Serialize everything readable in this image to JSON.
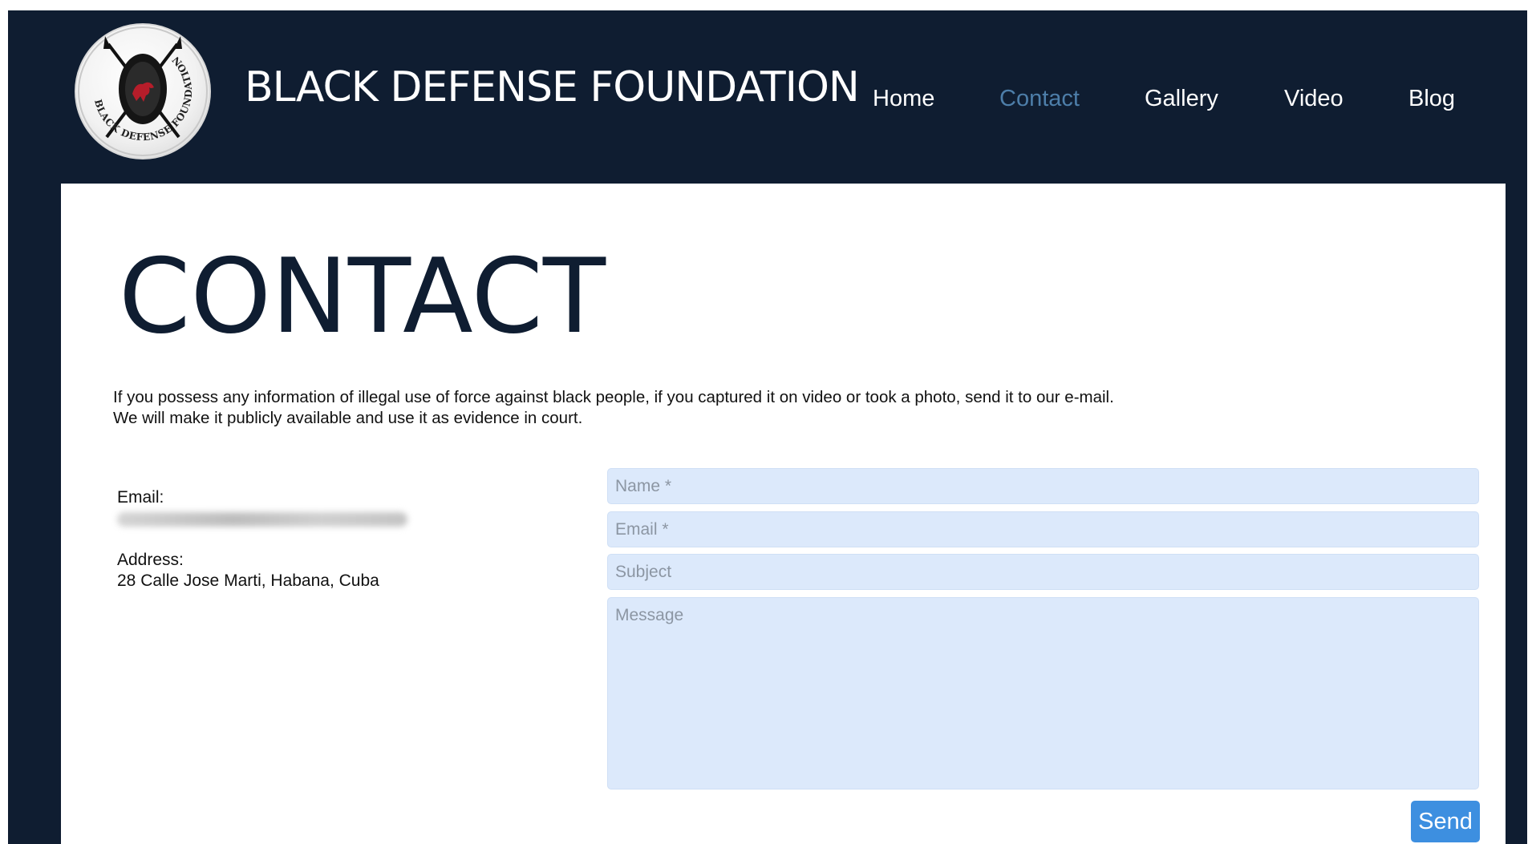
{
  "header": {
    "brand": "BLACK DEFENSE FOUNDATION",
    "logo_text": "BLACK DEFENSE FOUNDATION",
    "nav": [
      {
        "label": "Home",
        "active": false
      },
      {
        "label": "Contact",
        "active": true
      },
      {
        "label": "Gallery",
        "active": false
      },
      {
        "label": "Video",
        "active": false
      },
      {
        "label": "Blog",
        "active": false
      }
    ]
  },
  "main": {
    "title": "CONTACT",
    "intro": "If you possess any information of illegal use of force against black people, if you captured it on video or took a photo, send it to our e-mail. We will make it publicly available and use it as evidence in court.",
    "email_label": "Email:",
    "address_label": "Address:",
    "address_value": "28 Calle Jose Marti, Habana, Cuba"
  },
  "form": {
    "name_placeholder": "Name *",
    "email_placeholder": "Email *",
    "subject_placeholder": "Subject",
    "message_placeholder": "Message",
    "send_label": "Send"
  },
  "colors": {
    "header_bg": "#0f1d31",
    "nav_active": "#4d7ea9",
    "field_bg": "#dce9fb",
    "send_button": "#3d8fe0"
  },
  "icons": {
    "logo": "shield-with-crossed-spears-and-lion-emblem"
  }
}
